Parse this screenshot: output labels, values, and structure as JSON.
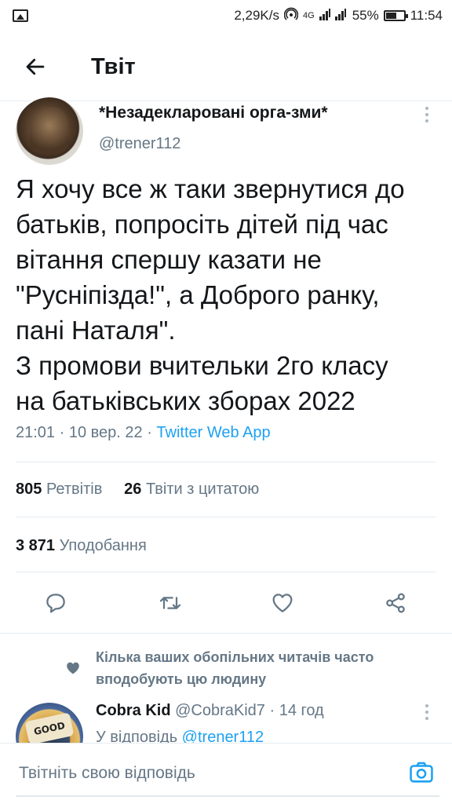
{
  "status_bar": {
    "speed": "2,29K/s",
    "network": "4G",
    "battery": "55%",
    "time": "11:54"
  },
  "header": {
    "title": "Твіт"
  },
  "tweet": {
    "display_name": "*Незадекларовані орга-зми*",
    "username": "@trener112",
    "text_lines": [
      "Я хочу все ж таки звернутися до",
      "батьків, попросіть дітей під час",
      "вітання спершу казати не",
      "\"Руснiпiзда!\", а Доброго ранку,",
      "пані Наталя\".",
      "З промови вчительки 2го класу",
      "на батьківських зборах 2022"
    ],
    "time": "21:01 · 10 вер. 22 · ",
    "app": "Twitter Web App",
    "retweets_count": "805",
    "retweets_label": "Ретвітів",
    "quotes_count": "26",
    "quotes_label": "Твіти з цитатою",
    "likes_count": "3 871",
    "likes_label": "Уподобання"
  },
  "social_context": {
    "line1": "Кілька ваших обопільних читачів часто",
    "line2": "вподобують цю людину"
  },
  "reply": {
    "display_name": "Cobra Kid",
    "username_time": " @CobraKid7 · 14 год",
    "replying_to_prefix": "У відповідь ",
    "replying_to_user": "@trener112",
    "avatar_text": "GOOD LUCK"
  },
  "composer": {
    "placeholder": "Твітніть свою відповідь"
  },
  "colors": {
    "accent": "#1da1f2",
    "secondary_text": "#657786",
    "divider": "#e6ecf0"
  }
}
